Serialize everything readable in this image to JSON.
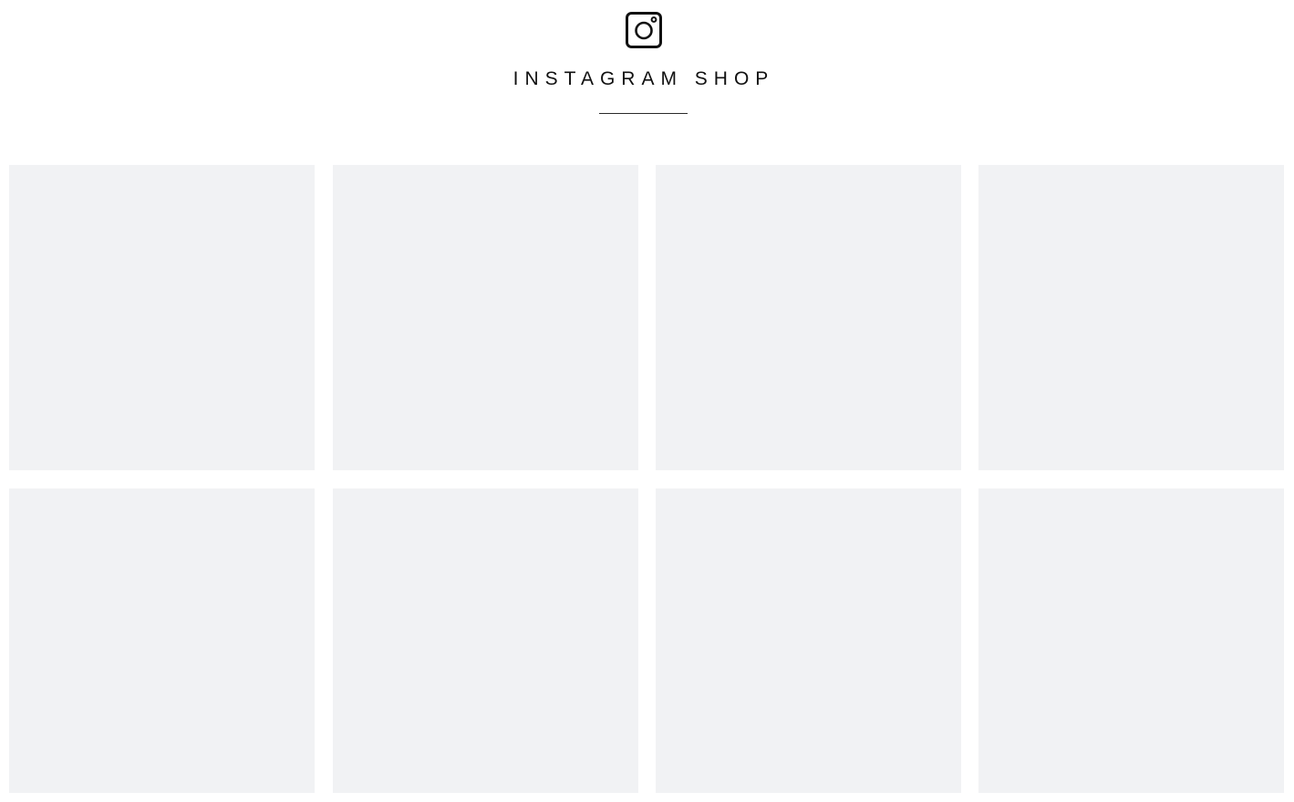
{
  "header": {
    "icon": "instagram-icon",
    "title": "INSTAGRAM SHOP"
  },
  "grid": {
    "columns": 4,
    "rows": 2,
    "tile_count": 8,
    "tile_color": "#f1f2f4"
  }
}
